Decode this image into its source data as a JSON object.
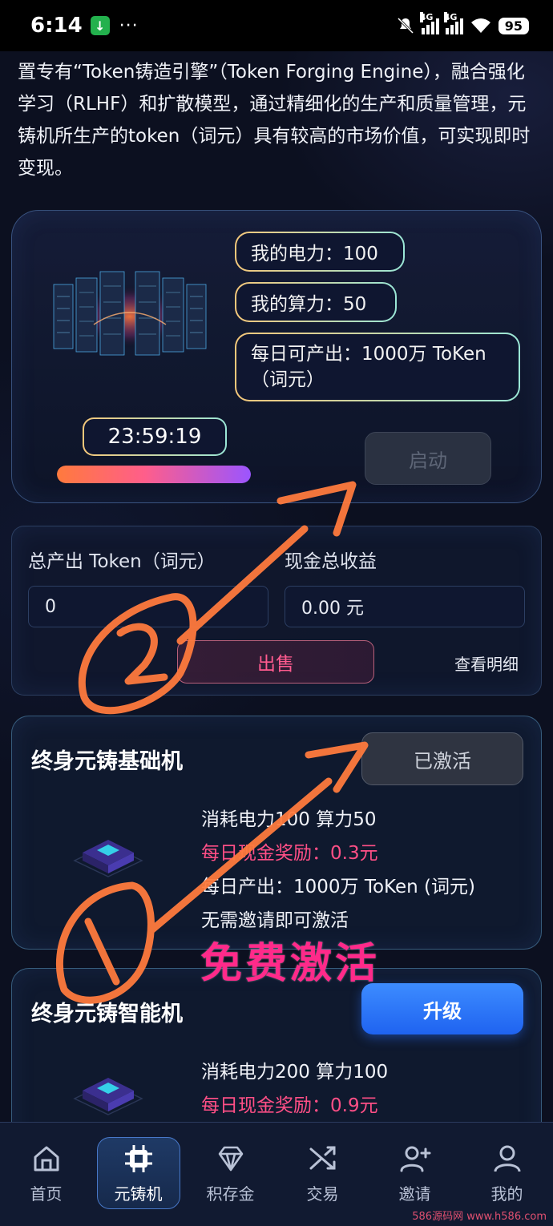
{
  "status_bar": {
    "time": "6:14",
    "battery": "95",
    "net1": "4G",
    "net2": "4G"
  },
  "intro": {
    "text": "置专有“Token铸造引擎”（Token Forging Engine），融合强化学习（RLHF）和扩散模型，通过精细化的生产和质量管理，元铸机所生产的token（词元）具有较高的市场价值，可实现即时变现。"
  },
  "engine": {
    "power_label": "我的电力：100",
    "compute_label": "我的算力：50",
    "daily_output": "每日可产出：1000万 ToKen（词元）",
    "timer": "23:59:19",
    "progress_fraction": 1.0,
    "start_button": "启动"
  },
  "output": {
    "token_label": "总产出 Token（词元）",
    "cash_label": "现金总收益",
    "token_value": "0",
    "cash_value": "0.00 元",
    "sell_button": "出售",
    "detail_link": "查看明细"
  },
  "machines": [
    {
      "title": "终身元铸基础机",
      "button": "已激活",
      "consume": "消耗电力100 算力50",
      "reward": "每日现金奖励：0.3元",
      "daily": "每日产出：1000万 ToKen (词元)",
      "note": "无需邀请即可激活"
    },
    {
      "title": "终身元铸智能机",
      "button": "升级",
      "consume": "消耗电力200 算力100",
      "reward": "每日现金奖励：0.9元"
    }
  ],
  "overlay": {
    "free_activate": "免费激活"
  },
  "nav": {
    "items": [
      {
        "label": "首页",
        "icon": "home-icon"
      },
      {
        "label": "元铸机",
        "icon": "chip-icon"
      },
      {
        "label": "积存金",
        "icon": "diamond-icon"
      },
      {
        "label": "交易",
        "icon": "shuffle-icon"
      },
      {
        "label": "邀请",
        "icon": "add-user-icon"
      },
      {
        "label": "我的",
        "icon": "user-icon"
      }
    ],
    "active": "元铸机"
  },
  "watermark": "586源码网 www.h586.com",
  "colors": {
    "background": "#0c1020",
    "accent_blue": "#2f7bff",
    "accent_pink": "#ff4f86",
    "annotation_orange": "#ff7a3d"
  }
}
